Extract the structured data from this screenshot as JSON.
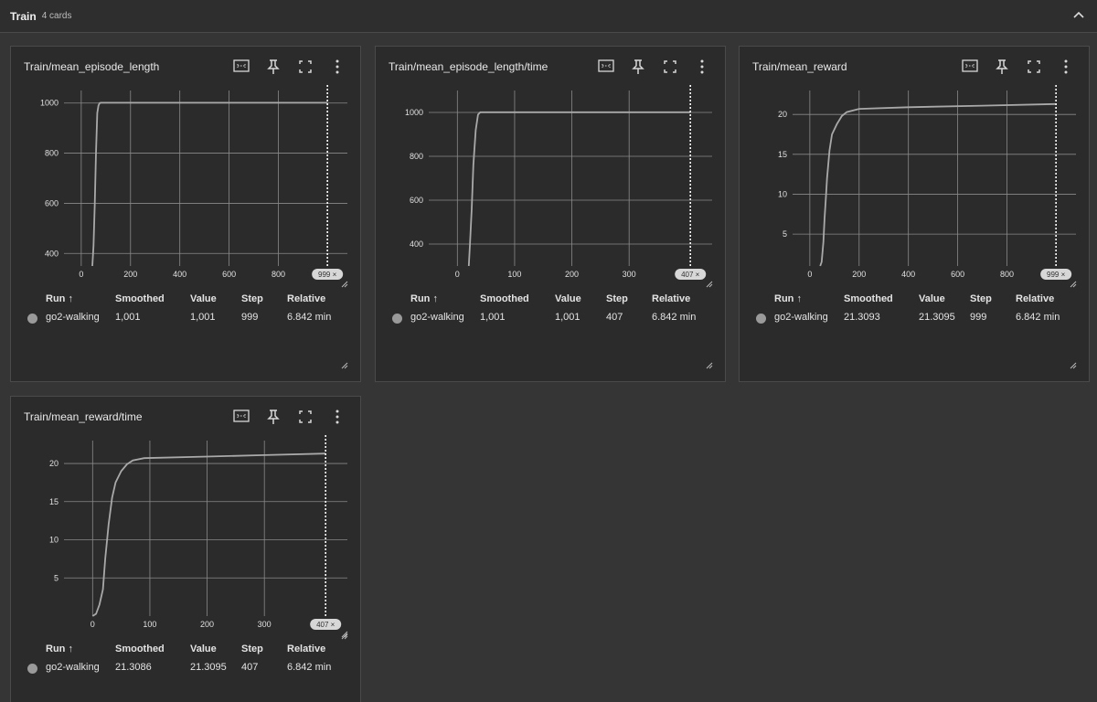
{
  "section": {
    "title": "Train",
    "count": "4 cards"
  },
  "table_headers": {
    "run": "Run ↑",
    "smoothed": "Smoothed",
    "value": "Value",
    "step": "Step",
    "relative": "Relative"
  },
  "cards": [
    {
      "title": "Train/mean_episode_length",
      "badge": "999 ×",
      "row": {
        "run": "go2-walking",
        "smoothed": "1,001",
        "value": "1,001",
        "step": "999",
        "relative": "6.842 min"
      }
    },
    {
      "title": "Train/mean_episode_length/time",
      "badge": "407 ×",
      "row": {
        "run": "go2-walking",
        "smoothed": "1,001",
        "value": "1,001",
        "step": "407",
        "relative": "6.842 min"
      }
    },
    {
      "title": "Train/mean_reward",
      "badge": "999 ×",
      "row": {
        "run": "go2-walking",
        "smoothed": "21.3093",
        "value": "21.3095",
        "step": "999",
        "relative": "6.842 min"
      }
    },
    {
      "title": "Train/mean_reward/time",
      "badge": "407 ×",
      "row": {
        "run": "go2-walking",
        "smoothed": "21.3086",
        "value": "21.3095",
        "step": "407",
        "relative": "6.842 min"
      }
    }
  ],
  "chart_data": [
    {
      "type": "line",
      "xticks": [
        0,
        200,
        400,
        600,
        800
      ],
      "yticks": [
        400,
        600,
        800,
        1000
      ],
      "xlim": [
        -70,
        1080
      ],
      "ylim": [
        350,
        1050
      ],
      "cursor_x": 999,
      "series": [
        {
          "x": [
            45,
            50,
            55,
            60,
            65,
            70,
            75,
            80,
            100,
            400,
            800,
            999
          ],
          "y": [
            350,
            430,
            600,
            800,
            960,
            990,
            1000,
            1001,
            1001,
            1001,
            1001,
            1001
          ]
        }
      ]
    },
    {
      "type": "line",
      "xticks": [
        0,
        100,
        200,
        300
      ],
      "yticks": [
        400,
        600,
        800,
        1000
      ],
      "xlim": [
        -50,
        445
      ],
      "ylim": [
        300,
        1100
      ],
      "cursor_x": 407,
      "series": [
        {
          "x": [
            20,
            22,
            25,
            28,
            32,
            36,
            40,
            60,
            200,
            407
          ],
          "y": [
            300,
            400,
            560,
            760,
            920,
            990,
            1001,
            1001,
            1001,
            1001
          ]
        }
      ]
    },
    {
      "type": "line",
      "xticks": [
        0,
        200,
        400,
        600,
        800
      ],
      "yticks": [
        5,
        10,
        15,
        20
      ],
      "xlim": [
        -70,
        1080
      ],
      "ylim": [
        1,
        23
      ],
      "cursor_x": 999,
      "series": [
        {
          "x": [
            42,
            48,
            55,
            60,
            65,
            70,
            80,
            90,
            110,
            130,
            150,
            200,
            400,
            700,
            999
          ],
          "y": [
            1,
            1.5,
            4,
            7,
            9.5,
            12,
            15.5,
            17.5,
            18.8,
            19.8,
            20.3,
            20.7,
            20.9,
            21.1,
            21.3
          ]
        }
      ]
    },
    {
      "type": "line",
      "xticks": [
        0,
        100,
        200,
        300
      ],
      "yticks": [
        5,
        10,
        15,
        20
      ],
      "xlim": [
        -50,
        445
      ],
      "ylim": [
        0,
        23
      ],
      "cursor_x": 407,
      "series": [
        {
          "x": [
            0,
            6,
            12,
            18,
            22,
            28,
            34,
            40,
            50,
            60,
            70,
            90,
            200,
            300,
            407
          ],
          "y": [
            0,
            0.3,
            1.5,
            3.5,
            7.5,
            12,
            15.5,
            17.5,
            19,
            19.9,
            20.4,
            20.7,
            20.9,
            21.1,
            21.3
          ]
        }
      ]
    }
  ]
}
